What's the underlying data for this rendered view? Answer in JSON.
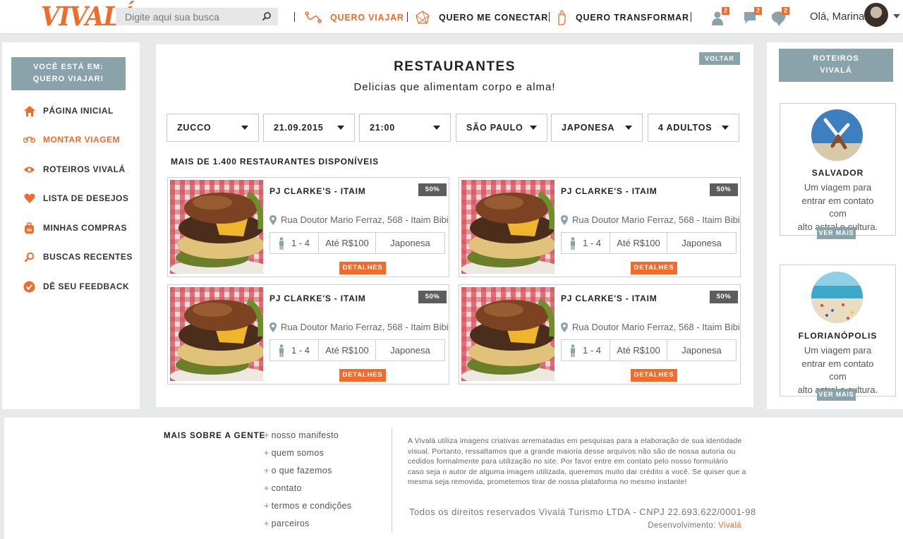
{
  "header": {
    "logo": "VIVALÁ",
    "search_placeholder": "Digite aqui sua busca",
    "nav": [
      {
        "label": "QUERO VIAJAR",
        "icon": "route-icon"
      },
      {
        "label": "QUERO ME CONECTAR",
        "icon": "network-icon"
      },
      {
        "label": "QUERO TRANSFORMAR",
        "icon": "hand-icon"
      }
    ],
    "badges": {
      "users": "2",
      "messages": "2",
      "map": "2"
    },
    "greeting": "Olá, Marina"
  },
  "sidebar": {
    "location_line1": "VOCÊ ESTÁ EM:",
    "location_line2": "QUERO VIAJAR!",
    "items": [
      {
        "label": "PÁGINA INICIAL",
        "icon": "home-icon"
      },
      {
        "label": "MONTAR VIAGEM",
        "icon": "bike-icon"
      },
      {
        "label": "ROTEIROS VIVALÁ",
        "icon": "eye-icon"
      },
      {
        "label": "LISTA DE DESEJOS",
        "icon": "heart-icon"
      },
      {
        "label": "MINHAS COMPRAS",
        "icon": "backpack-icon"
      },
      {
        "label": "BUSCAS RECENTES",
        "icon": "search-icon"
      },
      {
        "label": "DÊ SEU FEEDBACK",
        "icon": "check-icon"
      }
    ]
  },
  "main": {
    "back_label": "VOLTAR",
    "title": "RESTAURANTES",
    "subtitle": "Delicias que alimentam corpo e alma!",
    "filters": [
      "ZUCCO",
      "21.09.2015",
      "21:00",
      "SÃO PAULO",
      "JAPONESA",
      "4 ADULTOS"
    ],
    "count_label": "MAIS DE 1.400 RESTAURANTES DISPONÍVEIS",
    "cards": [
      {
        "title": "PJ CLARKE'S - ITAIM",
        "discount": "50%",
        "address": "Rua Doutor Mario Ferraz, 568 - Itaim Bibi",
        "people": "1 - 4",
        "price": "Até R$100",
        "cuisine": "Japonesa",
        "button": "DETALHES"
      },
      {
        "title": "PJ CLARKE'S - ITAIM",
        "discount": "50%",
        "address": "Rua Doutor Mario Ferraz, 568 - Itaim Bibi",
        "people": "1 - 4",
        "price": "Até R$100",
        "cuisine": "Japonesa",
        "button": "DETALHES"
      },
      {
        "title": "PJ CLARKE'S - ITAIM",
        "discount": "50%",
        "address": "Rua Doutor Mario Ferraz, 568 - Itaim Bibi",
        "people": "1 - 4",
        "price": "Até R$100",
        "cuisine": "Japonesa",
        "button": "DETALHES"
      },
      {
        "title": "PJ CLARKE'S - ITAIM",
        "discount": "50%",
        "address": "Rua Doutor Mario Ferraz, 568 - Itaim Bibi",
        "people": "1 - 4",
        "price": "Até R$100",
        "cuisine": "Japonesa",
        "button": "DETALHES"
      }
    ]
  },
  "right": {
    "heading_line1": "ROTEIROS",
    "heading_line2": "VIVALÁ",
    "destinations": [
      {
        "name": "SALVADOR",
        "line1": "Um viagem para",
        "line2": "entrar em contato com",
        "line3": "alto astral e cultura.",
        "button": "VER MAIS"
      },
      {
        "name": "FLORIANÓPOLIS",
        "line1": "Um viagem para",
        "line2": "entrar em contato com",
        "line3": "alto astral e cultura.",
        "button": "VER MAIS"
      }
    ]
  },
  "footer": {
    "heading": "MAIS SOBRE A GENTE",
    "links": [
      "nosso manifesto",
      "quem somos",
      "o que fazemos",
      "contato",
      "termos e condições",
      "parceiros"
    ],
    "paragraph": "A Vivalá utiliza imagens criativas arrematadas em pesquisas para a elaboração de sua identidade visual. Portanto, ressaltamos que a grande maioria desse arquivos não são de nossa autoria ou cedidos formalmente para utilização no site. Por favor entre em contato pelo nosso formulário caso seja o autor de alguma imagem utilizada, queremos muito dar crédito a você. Se quiser que a mesma seja removida, prometemos tirar de nossa plataforma no mesmo instante!",
    "rights": "Todos os direitos reservados Vivalá Turismo LTDA   -   CNPJ 22.693.622/0001-98",
    "dev_prefix": "Desenvolvimento: ",
    "dev_brand": "Vivalá"
  },
  "colors": {
    "accent": "#f26b2a",
    "slate": "#8aa3ab",
    "badge_dark": "#5d5d5d"
  }
}
